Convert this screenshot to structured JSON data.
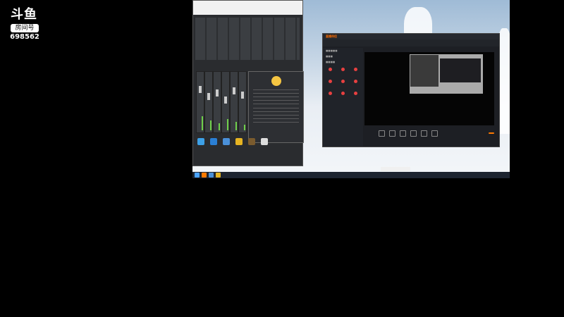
{
  "overlay": {
    "logo_text": "斗鱼",
    "room_label": "房间号",
    "room_number": "698562"
  },
  "taskbar": {
    "clock": ""
  },
  "obs": {
    "brand": "直播伴侣",
    "go_live": ""
  }
}
